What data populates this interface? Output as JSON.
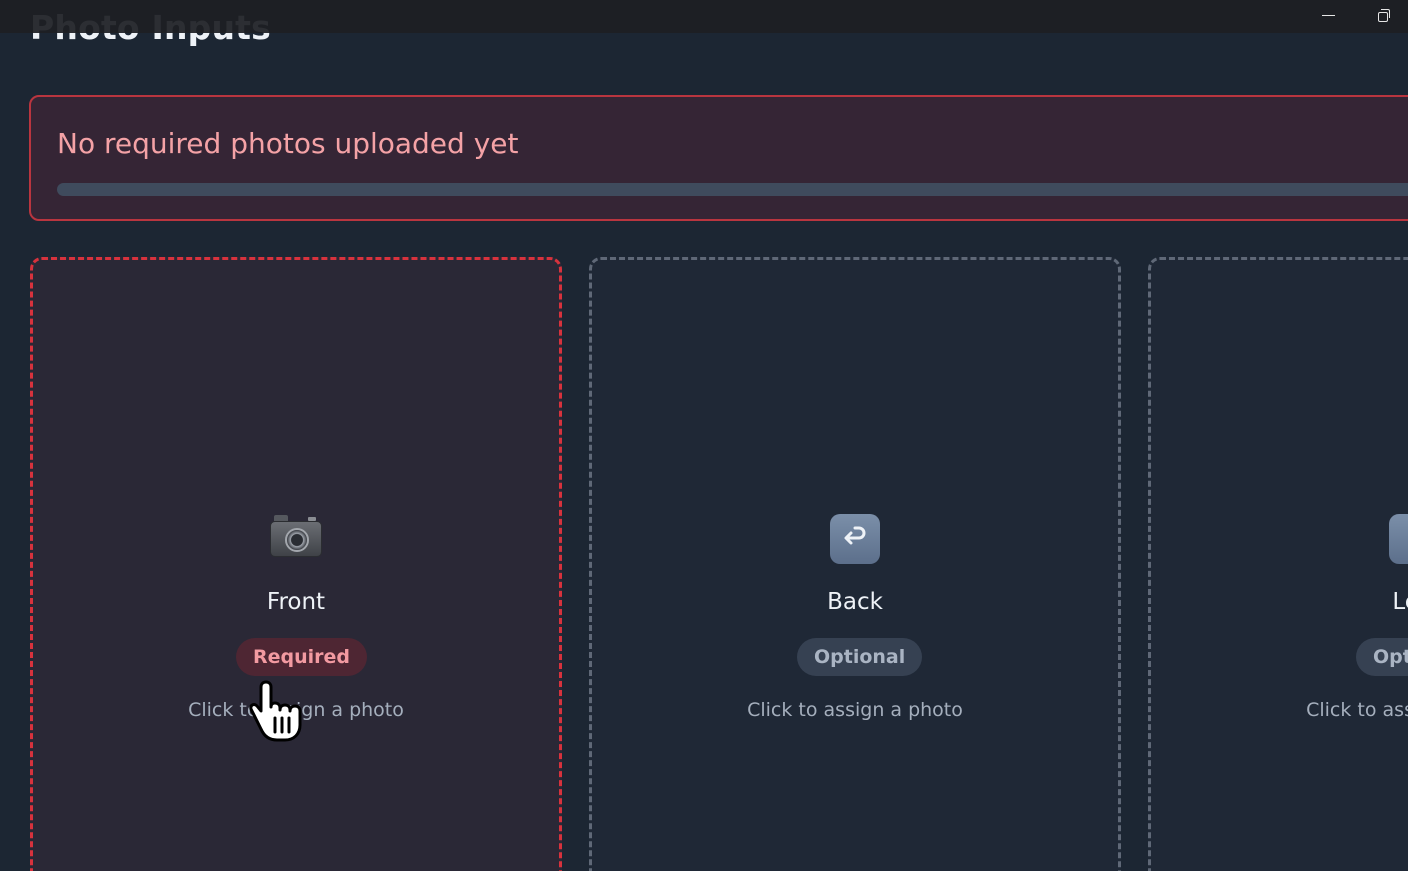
{
  "window": {
    "minimize_icon": "minimize-icon",
    "restore_icon": "restore-icon"
  },
  "page": {
    "title": "Photo Inputs"
  },
  "status": {
    "message": "No required photos uploaded yet",
    "progress_fraction": 0,
    "color": "#f4a2a6",
    "border_color": "#b9353f"
  },
  "slots": [
    {
      "label": "Front",
      "badge": "Required",
      "hint": "Click to assign a photo",
      "icon": "camera-icon"
    },
    {
      "label": "Back",
      "badge": "Optional",
      "hint": "Click to assign a photo",
      "icon": "back-arrow-icon"
    },
    {
      "label": "Left",
      "badge": "Optional",
      "hint": "Click to assign a photo",
      "icon": "left-arrow-icon"
    }
  ],
  "colors": {
    "background": "#1c2633",
    "required_accent": "#d7323d",
    "optional_border": "#5f6877"
  }
}
